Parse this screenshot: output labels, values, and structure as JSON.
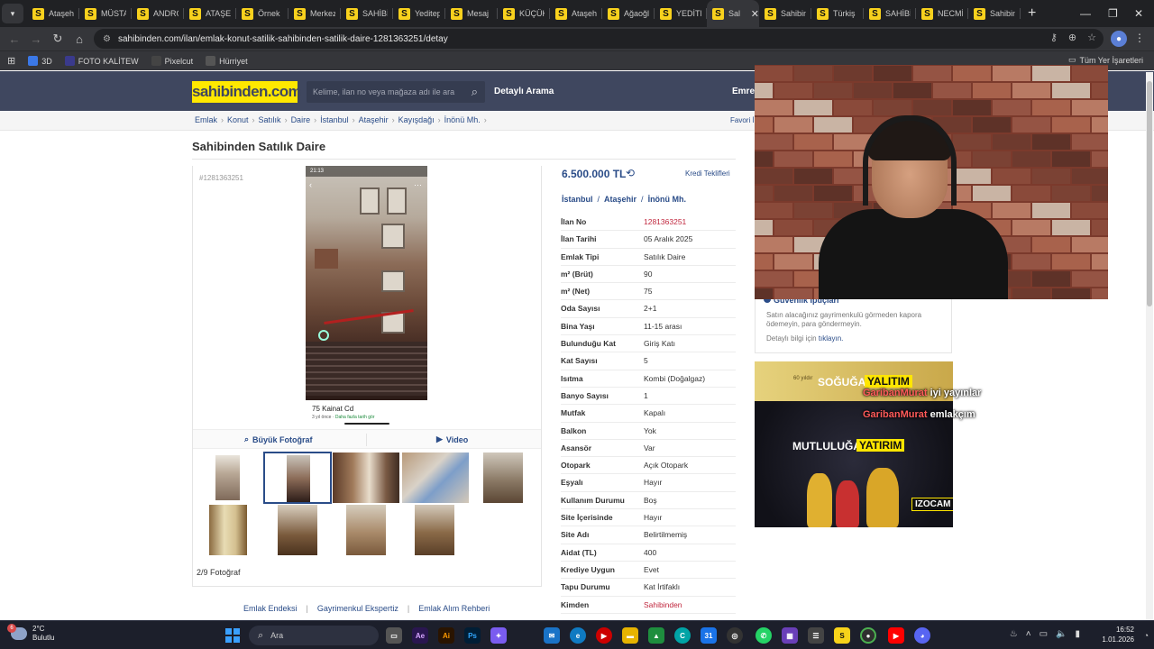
{
  "browser": {
    "tabs": [
      {
        "title": "Ataşeh"
      },
      {
        "title": "MÜSTA"
      },
      {
        "title": "ANDRO"
      },
      {
        "title": "ATAŞEH"
      },
      {
        "title": "Örnek"
      },
      {
        "title": "Merkez"
      },
      {
        "title": "SAHİBİ"
      },
      {
        "title": "Yeditep"
      },
      {
        "title": "Mesaj"
      },
      {
        "title": "KÜÇÜK"
      },
      {
        "title": "Ataşeh"
      },
      {
        "title": "Ağaoğl"
      },
      {
        "title": "YEDİTE"
      },
      {
        "title": "Sal",
        "active": true
      },
      {
        "title": "Sahibin"
      },
      {
        "title": "Türkiş"
      },
      {
        "title": "SAHİBİ"
      },
      {
        "title": "NECMİ"
      },
      {
        "title": "Sahibin"
      }
    ],
    "favicon_letter": "S",
    "new_tab": "+",
    "url": "sahibinden.com/ilan/emlak-konut-satilik-sahibinden-satilik-daire-1281363251/detay",
    "bookmarks": [
      {
        "label": "3D",
        "color": "#3b78e7"
      },
      {
        "label": "FOTO KALİTEW",
        "color": "#3a3a8c"
      },
      {
        "label": "Pixelcut",
        "color": "#444444"
      },
      {
        "label": "Hürriyet",
        "color": "#555555"
      }
    ],
    "all_bookmarks": "Tüm Yer İşaretleri"
  },
  "site": {
    "logo": "sahibinden.com",
    "search_placeholder": "Kelime, ilan no veya mağaza adı ile ara",
    "advanced_search": "Detaylı Arama",
    "user": "Emre",
    "breadcrumbs": [
      "Emlak",
      "Konut",
      "Satılık",
      "Daire",
      "İstanbul",
      "Ataşehir",
      "Kayışdağı",
      "İnönü Mh."
    ],
    "favorites": "Favori İ"
  },
  "listing": {
    "title": "Sahibinden Satılık Daire",
    "listing_no_small": "#1281363251",
    "price": "6.500.000 TL",
    "credit_link": "Kredi Teklifleri",
    "location": [
      "İstanbul",
      "Ataşehir",
      "İnönü Mh."
    ],
    "photo": {
      "status_time": "21:13",
      "caption_title": "75 Kainat Cd",
      "caption_sub": "3 yıl önce · ",
      "caption_link": "Daha fazla tarih gör"
    },
    "large_photo": "Büyük Fotoğraf",
    "video": "Video",
    "photo_count": "2/9 Fotoğraf",
    "details": [
      {
        "label": "İlan No",
        "value": "1281363251",
        "red": true
      },
      {
        "label": "İlan Tarihi",
        "value": "05 Aralık 2025"
      },
      {
        "label": "Emlak Tipi",
        "value": "Satılık Daire"
      },
      {
        "label": "m² (Brüt)",
        "value": "90"
      },
      {
        "label": "m² (Net)",
        "value": "75"
      },
      {
        "label": "Oda Sayısı",
        "value": "2+1"
      },
      {
        "label": "Bina Yaşı",
        "value": "11-15 arası"
      },
      {
        "label": "Bulunduğu Kat",
        "value": "Giriş Katı"
      },
      {
        "label": "Kat Sayısı",
        "value": "5"
      },
      {
        "label": "Isıtma",
        "value": "Kombi (Doğalgaz)"
      },
      {
        "label": "Banyo Sayısı",
        "value": "1"
      },
      {
        "label": "Mutfak",
        "value": "Kapalı"
      },
      {
        "label": "Balkon",
        "value": "Yok"
      },
      {
        "label": "Asansör",
        "value": "Var"
      },
      {
        "label": "Otopark",
        "value": "Açık Otopark"
      },
      {
        "label": "Eşyalı",
        "value": "Hayır"
      },
      {
        "label": "Kullanım Durumu",
        "value": "Boş"
      },
      {
        "label": "Site İçerisinde",
        "value": "Hayır"
      },
      {
        "label": "Site Adı",
        "value": "Belirtilmemiş"
      },
      {
        "label": "Aidat (TL)",
        "value": "400"
      },
      {
        "label": "Krediye Uygun",
        "value": "Evet"
      },
      {
        "label": "Tapu Durumu",
        "value": "Kat İrtifaklı"
      },
      {
        "label": "Kimden",
        "value": "Sahibinden",
        "red": true
      }
    ],
    "footer_links": [
      "Emlak Endeksi",
      "Gayrimenkul Ekspertiz",
      "Emlak Alım Rehberi"
    ]
  },
  "security": {
    "title": "Güvenlik İpuçları",
    "text": "Satın alacağınız gayrimenkulü görmeden kapora ödemeyin, para göndermeyin.",
    "more_prefix": "Detaylı bilgi için ",
    "more_link": "tıklayın."
  },
  "ad": {
    "small": "60 yıldır",
    "line1a": "SOĞUĞA",
    "line1b": "YALITIM",
    "line2a": "MUTLULUĞA",
    "line2b": "YATIRIM",
    "logo": "IZOCAM"
  },
  "overlay": {
    "line1_name": "GaribanMurat",
    "line1_text": "iyi yayınlar",
    "line2_name": "GaribanMurat",
    "line2_text": "emlakçım"
  },
  "taskbar": {
    "temp": "2°C",
    "weather": "Bulutlu",
    "weather_badge": "6",
    "search": "Ara",
    "time": "16:52",
    "date": "1.01.2026"
  }
}
